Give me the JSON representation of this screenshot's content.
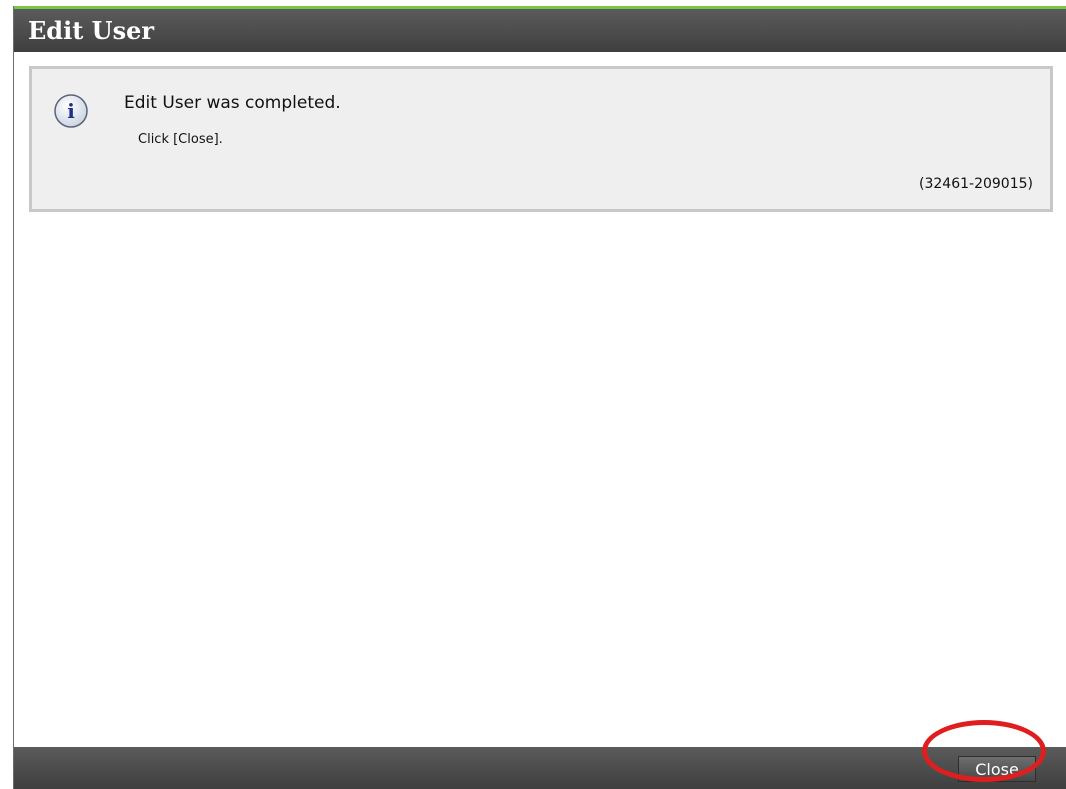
{
  "dialog": {
    "title": "Edit User"
  },
  "message": {
    "icon": "info-icon",
    "title": "Edit User was completed.",
    "detail": "Click [Close].",
    "code": "(32461-209015)"
  },
  "footer": {
    "close_label": "Close"
  },
  "colors": {
    "title_accent": "#7cc34a",
    "bar_background": "#4a4a4a",
    "message_background": "#efefef",
    "highlight": "#e01e1e"
  }
}
